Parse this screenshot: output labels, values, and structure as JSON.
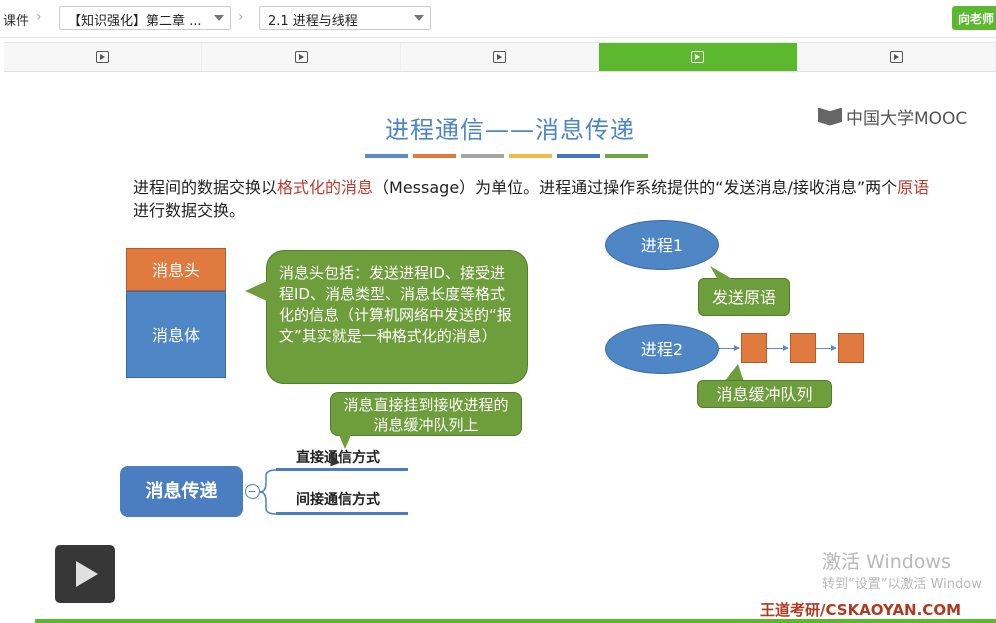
{
  "breadcrumb": {
    "root": "课件",
    "chapter_select": "【知识强化】第二章 ...",
    "lesson_select": "2.1 进程与线程"
  },
  "ask_teacher_button": "向老师",
  "tabs": [
    {
      "icon": "play-icon",
      "active": false
    },
    {
      "icon": "play-icon",
      "active": false
    },
    {
      "icon": "play-icon",
      "active": false
    },
    {
      "icon": "play-icon",
      "active": true
    },
    {
      "icon": "play-icon",
      "active": false
    }
  ],
  "slide": {
    "title": "进程通信——消息传递",
    "title_bar_colors": [
      "#5b8bc8",
      "#e07a3f",
      "#a5a5a5",
      "#f2b84b",
      "#4472c4",
      "#70a444"
    ],
    "logo_text": "中国大学MOOC",
    "paragraph": {
      "p1": "进程间的数据交换以",
      "p2": "格式化的消息",
      "p3": "（Message）为单位。进程通过操作系统提供的“发送消息/接收消息”两个",
      "p4": "原语",
      "p5": "进行数据交换。"
    },
    "message_head": "消息头",
    "message_body": "消息体",
    "callout_head_desc": "消息头包括：发送进程ID、接受进程ID、消息类型、消息长度等格式化的信息（计算机网络中发送的“报文”其实就是一种格式化的消息）",
    "callout_direct_desc": "消息直接挂到接收进程的消息缓冲队列上",
    "mindmap": {
      "root": "消息传递",
      "branch1": "直接通信方式",
      "branch2": "间接通信方式"
    },
    "process1": "进程1",
    "process2": "进程2",
    "send_primitive": "发送原语",
    "queue_label": "消息缓冲队列"
  },
  "watermark": {
    "line1": "激活 Windows",
    "line2": "转到“设置”以激活 Window",
    "site": "王道考研/CSKAOYAN.COM"
  },
  "colors": {
    "accent_green": "#5cb82e",
    "blue": "#4f86c6",
    "orange": "#e07a3f",
    "callout_green": "#6e9d3b"
  }
}
